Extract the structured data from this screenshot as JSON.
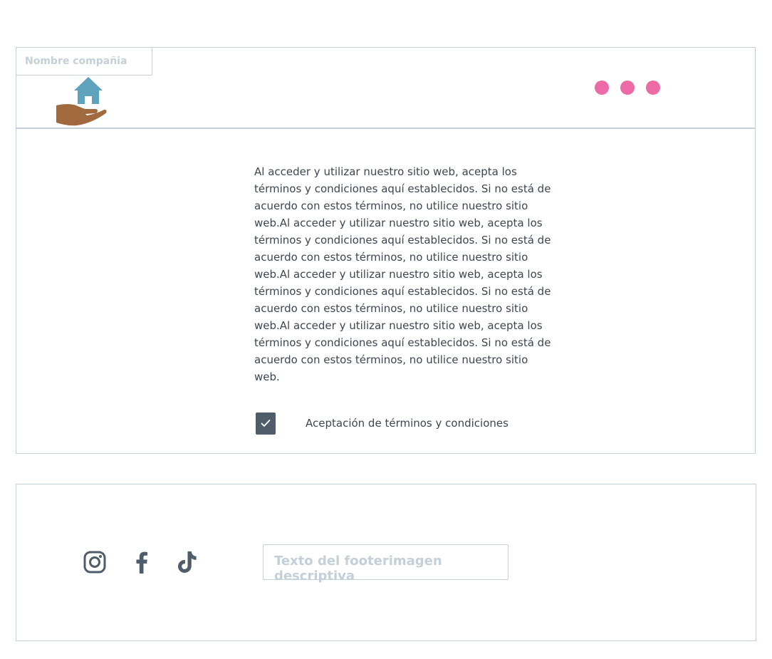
{
  "header": {
    "company_placeholder": "Nombre compañia",
    "logo_icon": "house-in-hand-icon",
    "menu_icon": "three-dots-menu-icon",
    "dot_color": "#ec6aa6"
  },
  "main": {
    "terms_text": "Al acceder y utilizar nuestro sitio web, acepta los términos y condiciones aquí establecidos. Si no está de acuerdo con estos términos, no utilice nuestro sitio web.Al acceder y utilizar nuestro sitio web, acepta los términos y condiciones aquí establecidos. Si no está de acuerdo con estos términos, no utilice nuestro sitio web.Al acceder y utilizar nuestro sitio web, acepta los términos y condiciones aquí establecidos. Si no está de acuerdo con estos términos, no utilice nuestro sitio web.Al acceder y utilizar nuestro sitio web, acepta los términos y condiciones aquí establecidos. Si no está de acuerdo con estos términos, no utilice nuestro sitio web.",
    "checkbox_checked": true,
    "checkbox_label": "Aceptación de términos y condiciones"
  },
  "footer": {
    "social_icons": [
      "instagram-icon",
      "facebook-icon",
      "tiktok-icon"
    ],
    "footer_placeholder": "Texto del footerimagen descriptiva"
  },
  "colors": {
    "border": "#c3cfd9",
    "text": "#3b4652",
    "accent_pink": "#ec6aa6",
    "checkbox": "#4f5d6b",
    "house": "#5fa2bd",
    "hand": "#a06a3e"
  }
}
